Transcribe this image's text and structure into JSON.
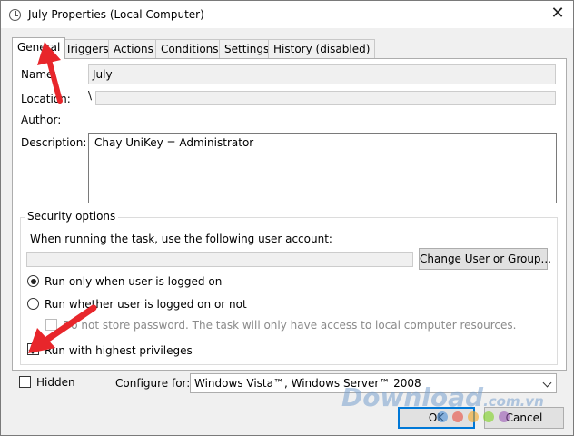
{
  "window": {
    "title": "July Properties (Local Computer)",
    "close_glyph": "✕"
  },
  "tabs": [
    {
      "label": "General",
      "active": true
    },
    {
      "label": "Triggers"
    },
    {
      "label": "Actions"
    },
    {
      "label": "Conditions"
    },
    {
      "label": "Settings"
    },
    {
      "label": "History (disabled)"
    }
  ],
  "general": {
    "name_label": "Name:",
    "name_value": "July",
    "location_label": "Location:",
    "location_value": "\\",
    "author_label": "Author:",
    "author_value": "",
    "description_label": "Description:",
    "description_value": "Chay UniKey = Administrator"
  },
  "security": {
    "title": "Security options",
    "account_prompt": "When running the task, use the following user account:",
    "account_value": "",
    "change_button": "Change User or Group...",
    "radio_logged_on": "Run only when user is logged on",
    "radio_whether": "Run whether user is logged on or not",
    "dont_store": "Do not store password.  The task will only have access to local computer resources.",
    "highest": "Run with highest privileges",
    "selected_radio": "logged_on",
    "highest_checked": true
  },
  "footer": {
    "hidden_label": "Hidden",
    "configure_label": "Configure for:",
    "configure_value": "Windows Vista™, Windows Server™ 2008",
    "ok": "OK",
    "cancel": "Cancel"
  },
  "watermark": {
    "text": "Download",
    "suffix": ".com.vn"
  },
  "colors": {
    "accent": "#0078d7",
    "arrow": "#e8262b"
  },
  "icons": {
    "title": "clock-icon",
    "close": "close-icon",
    "dropdown": "chevron-down-icon"
  }
}
